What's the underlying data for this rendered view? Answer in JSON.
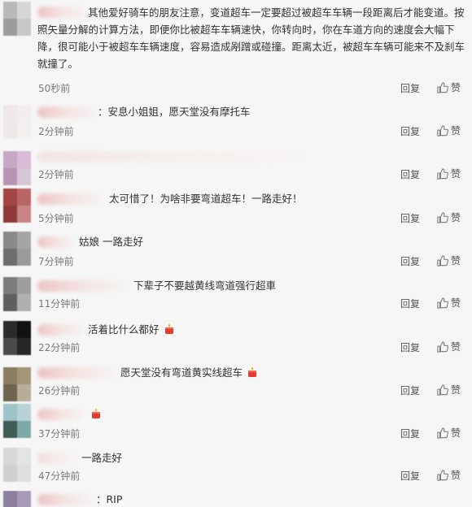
{
  "comments": [
    {
      "text": "其他爱好骑车的朋友注意，变道超车一定要超过被超车车辆一段距离后才能变道。按照矢量分解的计算方法，即便你比被超车车辆速快，你转向时，你在车道方向的速度会大幅下降，很可能小于被超车车辆速度，容易造成剐蹭或碰撞。距离太近，被超车车辆可能来不及刹车就撞了。",
      "time": "50秒前",
      "reply": "回复",
      "like": "赞",
      "avatar_colors": [
        "#b9b9b9",
        "#d6d6d6",
        "#9c9c9c",
        "#c8c8c8"
      ]
    },
    {
      "text": "：安息小姐姐，愿天堂没有摩托车",
      "time": "2分钟前",
      "reply": "回复",
      "like": "赞",
      "avatar_colors": [
        "#f0e8e8",
        "#f3eded",
        "#eee8e8",
        "#f4efef"
      ]
    },
    {
      "text": "",
      "time": "2分钟前",
      "reply": "回复",
      "like": "赞",
      "avatar_colors": [
        "#c8a7c6",
        "#d9bcd6",
        "#b894b3",
        "#d6c7d4"
      ]
    },
    {
      "text": "太可惜了！为啥非要弯道超车！一路走好！",
      "time": "5分钟前",
      "reply": "回复",
      "like": "赞",
      "avatar_colors": [
        "#a44545",
        "#b86565",
        "#8e3a3a",
        "#c98585"
      ]
    },
    {
      "text": "姑娘 一路走好",
      "time": "7分钟前",
      "reply": "回复",
      "like": "赞",
      "avatar_colors": [
        "#8a8a8a",
        "#a5a5a5",
        "#6e6e6e",
        "#9a9a9a"
      ]
    },
    {
      "text": "下辈子不要越黄线弯道强行超車",
      "time": "11分钟前",
      "reply": "回复",
      "like": "赞",
      "avatar_colors": [
        "#7c7c7c",
        "#9e9e9e",
        "#5f5f5f",
        "#b0b0b0"
      ]
    },
    {
      "text": "活着比什么都好",
      "time": "22分钟前",
      "reply": "回复",
      "like": "赞",
      "avatar_colors": [
        "#2b2b2b",
        "#111111",
        "#4a4a4a",
        "#262626"
      ]
    },
    {
      "text": "愿天堂没有弯道黄实线超车",
      "time": "26分钟前",
      "reply": "回复",
      "like": "赞",
      "avatar_colors": [
        "#8a7d62",
        "#a39577",
        "#6f6450",
        "#b7ad98"
      ]
    },
    {
      "text": "",
      "time": "37分钟前",
      "reply": "回复",
      "like": "赞",
      "avatar_colors": [
        "#9ec3c8",
        "#b8d3d5",
        "#3f5b53",
        "#7fa9a6"
      ]
    },
    {
      "text": "一路走好",
      "time": "47分钟前",
      "reply": "回复",
      "like": "赞",
      "avatar_colors": [
        "#d8d8d8",
        "#e4e4e4",
        "#cfcfcf",
        "#dedede"
      ]
    },
    {
      "text": "：RIP",
      "time": "",
      "reply": "",
      "like": "",
      "avatar_colors": [
        "#8d7fa0",
        "#a89bb8",
        "#7a6d8d",
        "#bdb2cc"
      ]
    }
  ],
  "icons": {
    "like": "thumbs-up-icon",
    "emoji": "candle-emoji-icon"
  }
}
